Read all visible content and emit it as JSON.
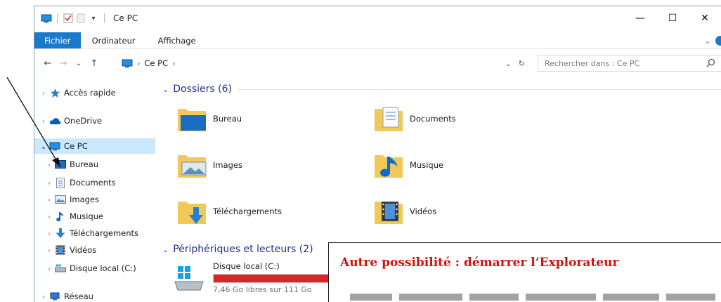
{
  "window": {
    "title": "Ce PC"
  },
  "titlebar": {
    "minimize": "—",
    "maximize": "☐",
    "close": "✕"
  },
  "ribbon": {
    "tabs": [
      "Fichier",
      "Ordinateur",
      "Affichage"
    ],
    "expand": "⌄"
  },
  "address": {
    "location": "Ce PC",
    "separator": "›",
    "dropdown": "⌄",
    "refresh": "↻"
  },
  "search": {
    "placeholder": "Rechercher dans : Ce PC",
    "icon": "⚲"
  },
  "nav": {
    "items": [
      {
        "label": "Accès rapide",
        "icon": "star-icon"
      },
      {
        "label": "OneDrive",
        "icon": "cloud-icon"
      },
      {
        "label": "Ce PC",
        "icon": "computer-icon",
        "selected": true
      },
      {
        "label": "Bureau",
        "icon": "desktop-icon"
      },
      {
        "label": "Documents",
        "icon": "documents-icon"
      },
      {
        "label": "Images",
        "icon": "images-icon"
      },
      {
        "label": "Musique",
        "icon": "music-icon"
      },
      {
        "label": "Téléchargements",
        "icon": "download-icon"
      },
      {
        "label": "Vidéos",
        "icon": "video-icon"
      },
      {
        "label": "Disque local (C:)",
        "icon": "drive-icon"
      },
      {
        "label": "Réseau",
        "icon": "network-icon"
      }
    ]
  },
  "content": {
    "folders_header": "Dossiers (6)",
    "folders": [
      "Bureau",
      "Documents",
      "Images",
      "Musique",
      "Téléchargements",
      "Vidéos"
    ],
    "devices_header": "Périphériques et lecteurs (2)",
    "drive": {
      "name": "Disque local (C:)",
      "free": "7,46 Go libres sur 111 Go",
      "used_fraction": 0.93
    }
  },
  "annotation": {
    "text": "Autre possibilité : démarrer l’Explorateur"
  },
  "colors": {
    "accent": "#1979ca",
    "header": "#1e3287",
    "selection": "#cce8ff",
    "drive_bar": "#da2626",
    "annotation": "#d11212"
  }
}
